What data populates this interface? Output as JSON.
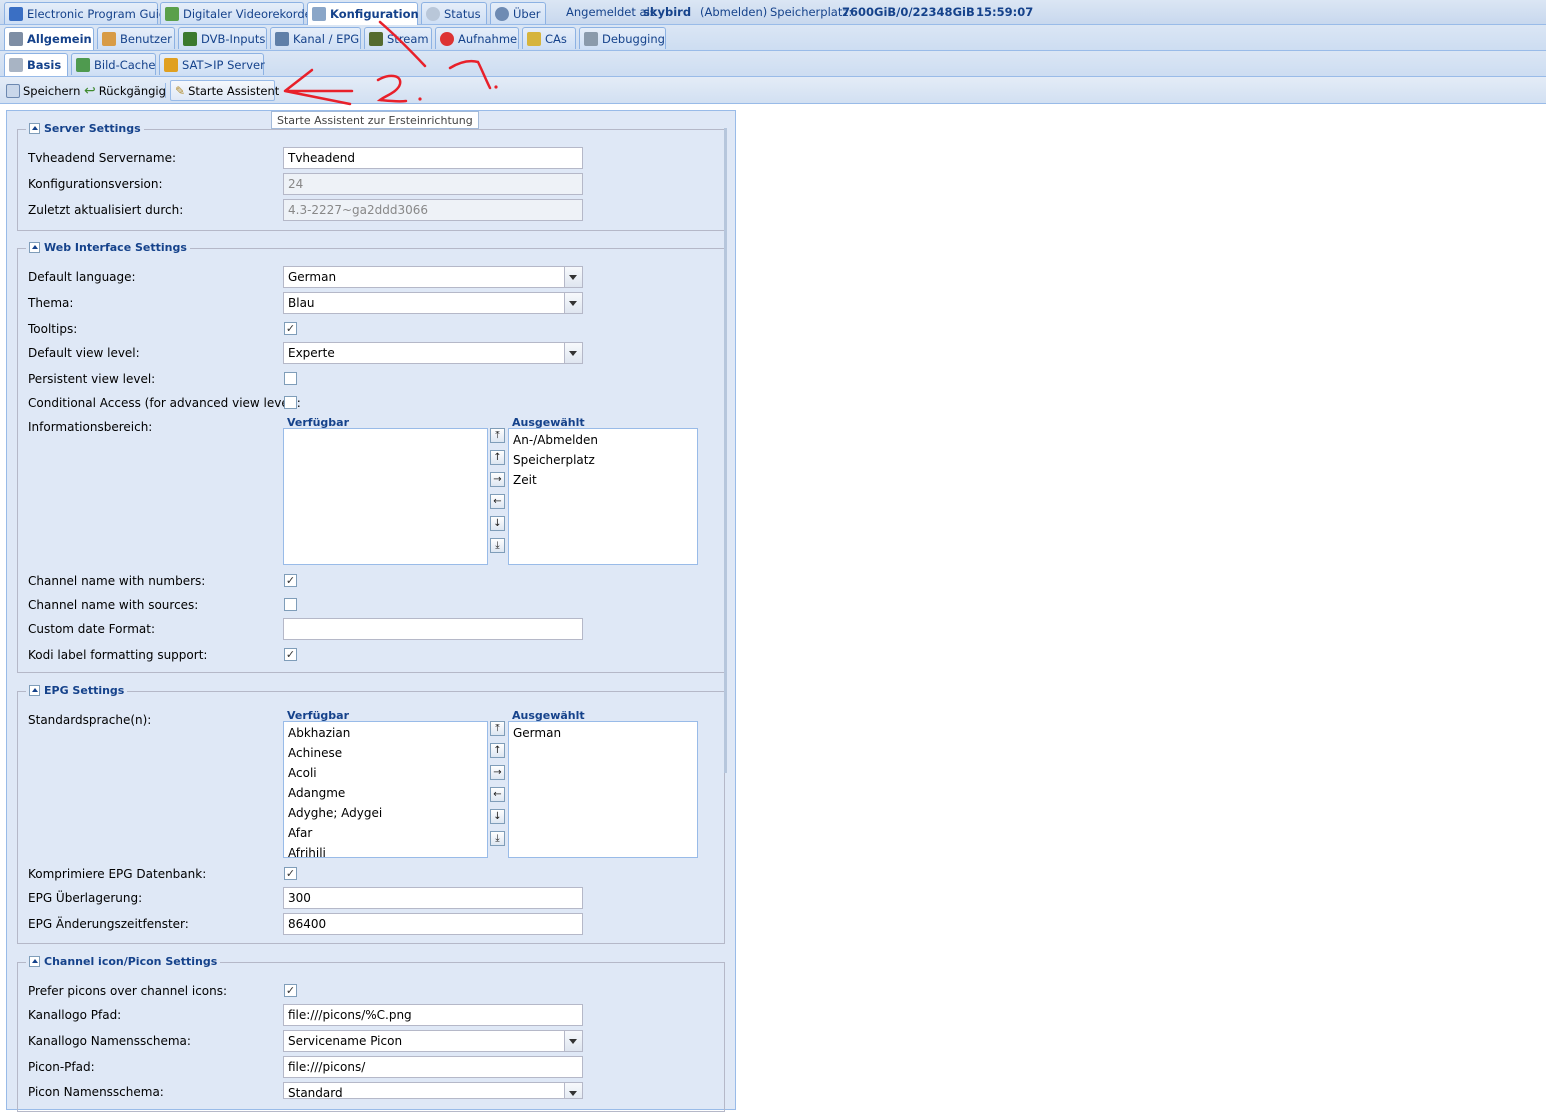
{
  "header": {
    "tabs": [
      {
        "label": "Electronic Program Guide",
        "icon": "epg-icon"
      },
      {
        "label": "Digitaler Videorekorder",
        "icon": "download-icon"
      },
      {
        "label": "Konfiguration",
        "icon": "wrench-icon"
      },
      {
        "label": "Status",
        "icon": "eye-icon"
      },
      {
        "label": "Über",
        "icon": "info-icon"
      }
    ],
    "logged_in_prefix": "Angemeldet als",
    "user": "skybird",
    "logout": "(Abmelden)",
    "storage_label": "Speicherplatz:",
    "storage_value": "7600GiB/0/22348GiB",
    "time": "15:59:07"
  },
  "config_tabs": [
    {
      "label": "Allgemein",
      "icon": "tools-icon"
    },
    {
      "label": "Benutzer",
      "icon": "users-icon"
    },
    {
      "label": "DVB-Inputs",
      "icon": "card-icon"
    },
    {
      "label": "Kanal / EPG",
      "icon": "tv-icon"
    },
    {
      "label": "Stream",
      "icon": "film-icon"
    },
    {
      "label": "Aufnahme",
      "icon": "rec-icon"
    },
    {
      "label": "CAs",
      "icon": "key-icon"
    },
    {
      "label": "Debugging",
      "icon": "bug-icon"
    }
  ],
  "sub_tabs": [
    {
      "label": "Basis",
      "icon": "gear-icon"
    },
    {
      "label": "Bild-Cache",
      "icon": "image-icon"
    },
    {
      "label": "SAT>IP Server",
      "icon": "satip-icon"
    }
  ],
  "toolbar": {
    "save": "Speichern",
    "undo": "Rückgängig",
    "wizard": "Starte Assistent",
    "wizard_tooltip": "Starte Assistent zur Ersteinrichtung"
  },
  "server": {
    "legend": "Server Settings",
    "servername_label": "Tvheadend Servername:",
    "servername_value": "Tvheadend",
    "configversion_label": "Konfigurationsversion:",
    "configversion_value": "24",
    "updated_label": "Zuletzt aktualisiert durch:",
    "updated_value": "4.3-2227~ga2ddd3066"
  },
  "web": {
    "legend": "Web Interface Settings",
    "language_label": "Default language:",
    "language_value": "German",
    "theme_label": "Thema:",
    "theme_value": "Blau",
    "tooltips_label": "Tooltips:",
    "tooltips_checked": true,
    "viewlevel_label": "Default view level:",
    "viewlevel_value": "Experte",
    "persistent_label": "Persistent view level:",
    "persistent_checked": false,
    "ca_label": "Conditional Access (for advanced view level):",
    "ca_checked": false,
    "info_label": "Informationsbereich:",
    "available_header": "Verfügbar",
    "selected_header": "Ausgewählt",
    "selected_items": [
      "An-/Abmelden",
      "Speicherplatz",
      "Zeit"
    ],
    "chnum_label": "Channel name with numbers:",
    "chnum_checked": true,
    "chsrc_label": "Channel name with sources:",
    "chsrc_checked": false,
    "dateformat_label": "Custom date Format:",
    "dateformat_value": "",
    "kodi_label": "Kodi label formatting support:",
    "kodi_checked": true
  },
  "epg": {
    "legend": "EPG Settings",
    "lang_label": "Standardsprache(n):",
    "available_header": "Verfügbar",
    "selected_header": "Ausgewählt",
    "available_items": [
      "Abkhazian",
      "Achinese",
      "Acoli",
      "Adangme",
      "Adyghe; Adygei",
      "Afar",
      "Afrihili"
    ],
    "selected_items": [
      "German"
    ],
    "compress_label": "Komprimiere EPG Datenbank:",
    "compress_checked": true,
    "overlap_label": "EPG Überlagerung:",
    "overlap_value": "300",
    "window_label": "EPG Änderungszeitfenster:",
    "window_value": "86400"
  },
  "picon": {
    "legend": "Channel icon/Picon Settings",
    "prefer_label": "Prefer picons over channel icons:",
    "prefer_checked": true,
    "logopath_label": "Kanallogo Pfad:",
    "logopath_value": "file:///picons/%C.png",
    "scheme_label": "Kanallogo Namensschema:",
    "scheme_value": "Servicename Picon",
    "piconpath_label": "Picon-Pfad:",
    "piconpath_value": "file:///picons/",
    "piconscheme_label": "Picon Namensschema:",
    "piconscheme_value": "Standard"
  },
  "colors": {
    "accent": "#15428b",
    "panel_bg": "#dfe8f6",
    "border": "#99bbe8",
    "annotation": "#e8202a"
  }
}
